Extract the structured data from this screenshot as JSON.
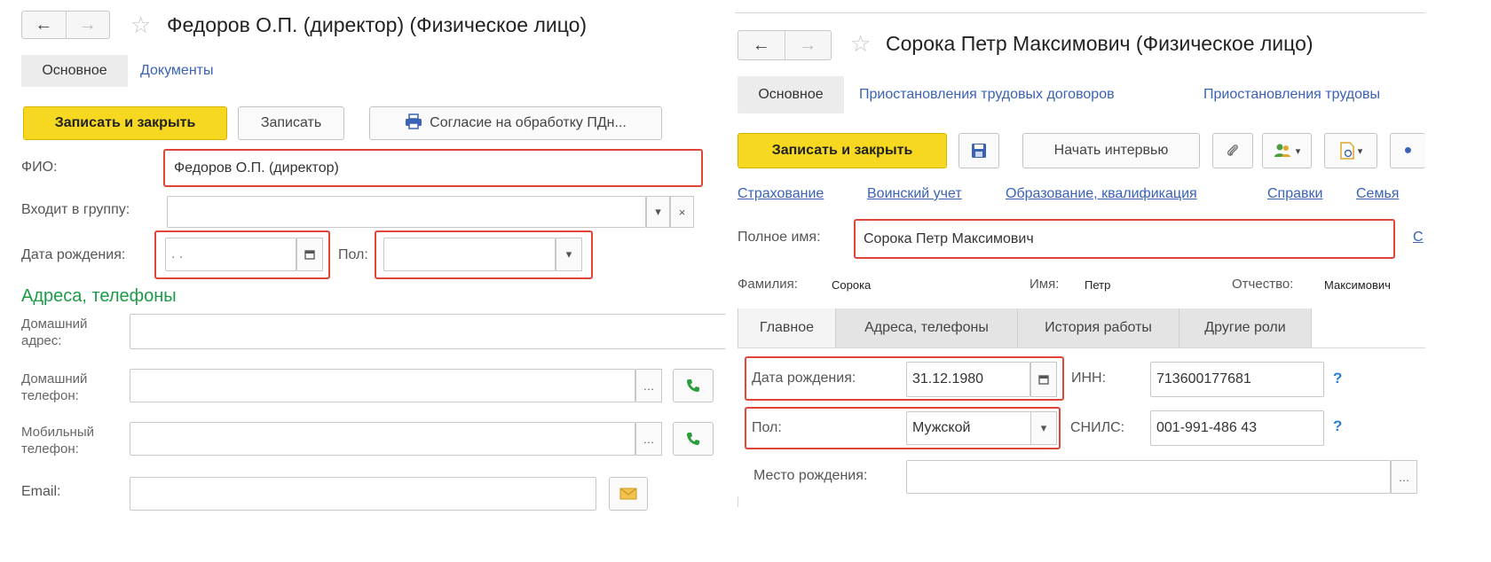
{
  "left": {
    "title": "Федоров О.П. (директор) (Физическое лицо)",
    "tabs": [
      "Основное",
      "Документы"
    ],
    "buttons": {
      "save_close": "Записать и закрыть",
      "save": "Записать",
      "consent": "Согласие на обработку ПДн..."
    },
    "fields": {
      "fio_label": "ФИО:",
      "fio_value": "Федоров О.П. (директор)",
      "group_label": "Входит в группу:",
      "birth_label": "Дата рождения:",
      "birth_value": ". .",
      "gender_label": "Пол:"
    },
    "section_title": "Адреса, телефоны",
    "contacts": {
      "home_addr_1": "Домашний",
      "home_addr_2": "адрес:",
      "home_phone_1": "Домашний",
      "home_phone_2": "телефон:",
      "mobile_1": "Мобильный",
      "mobile_2": "телефон:",
      "email": "Email:"
    }
  },
  "right": {
    "title": "Сорока Петр Максимович (Физическое лицо)",
    "tabs": [
      "Основное",
      "Приостановления трудовых договоров",
      "Приостановления трудовы"
    ],
    "buttons": {
      "save_close": "Записать и закрыть",
      "interview": "Начать интервью"
    },
    "links": [
      "Страхование",
      "Воинский учет",
      "Образование, квалификация",
      "Справки",
      "Семья"
    ],
    "full_name_label": "Полное имя:",
    "full_name_value": "Сорока Петр Максимович",
    "edge_letter": "С",
    "last_name_label": "Фамилия:",
    "last_name": "Сорока",
    "first_name_label": "Имя:",
    "first_name": "Петр",
    "patronymic_label": "Отчество:",
    "patronymic": "Максимович",
    "subtabs": [
      "Главное",
      "Адреса, телефоны",
      "История работы",
      "Другие роли"
    ],
    "birth_label": "Дата рождения:",
    "birth_value": "31.12.1980",
    "inn_label": "ИНН:",
    "inn_value": "713600177681",
    "gender_label": "Пол:",
    "gender_value": "Мужской",
    "snils_label": "СНИЛС:",
    "snils_value": "001-991-486 43",
    "birthplace_label": "Место рождения:",
    "help": "?"
  },
  "colors": {
    "accent_yellow": "#f5d81f",
    "section_green": "#1d9a48",
    "link_blue": "#3a62b5",
    "highlight_red": "#e0453a"
  }
}
